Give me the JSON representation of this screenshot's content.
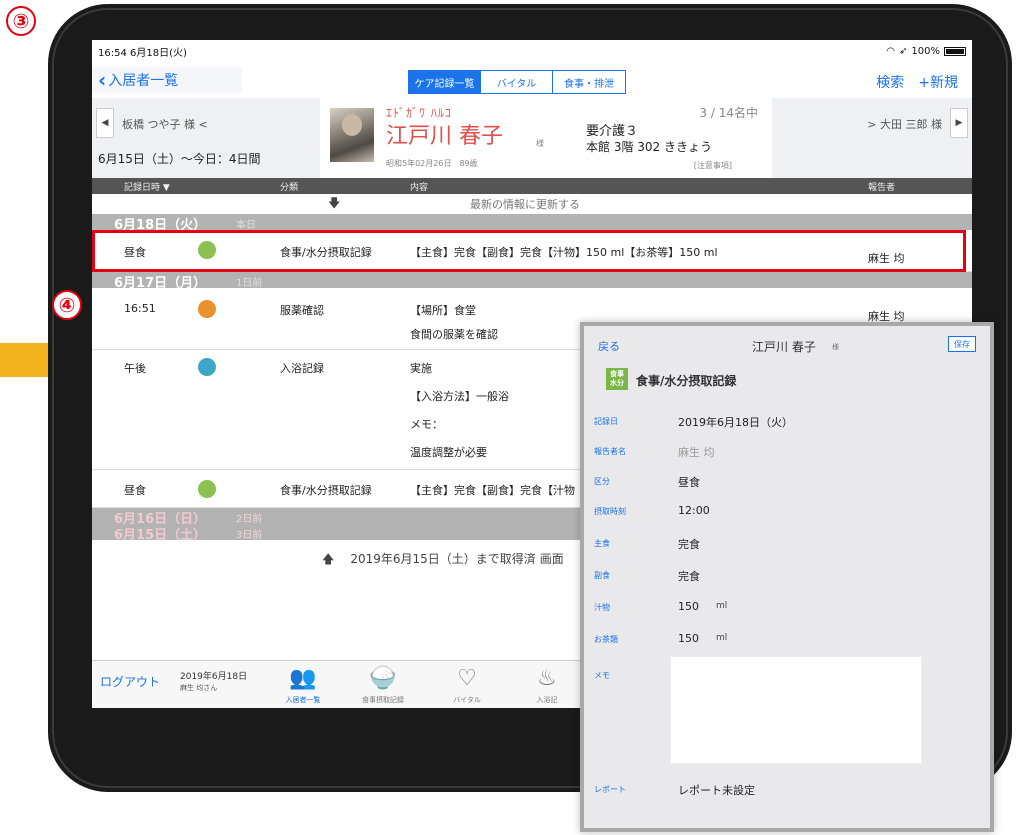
{
  "markers": {
    "step3": "③",
    "step4": "④"
  },
  "status": {
    "time": "16:54",
    "date": "6月18日(火)",
    "battery": "100%"
  },
  "nav": {
    "back": "入居者一覧",
    "tabs": [
      "ケア記録一覧",
      "バイタル",
      "食事・排泄"
    ],
    "active_tab": 0,
    "search": "検索",
    "new": "+新規"
  },
  "resident": {
    "prev": "板橋 つや子 様 <",
    "next": "> 大田 三郎 様",
    "range": "6月15日（土）〜今日：4日間",
    "kana": "ｴﾄﾞｶﾞﾜ ﾊﾙｺ",
    "name": "江戸川 春子",
    "sama": "様",
    "birth": "昭和5年02月26日　89歳",
    "count": "3 / 14名中",
    "care": "要介護３",
    "room": "本館 3階 302 ききょう",
    "notice": "[注意事項]"
  },
  "table_header": {
    "datetime": "記録日時 ▼",
    "category": "分類",
    "content": "内容",
    "reporter": "報告者"
  },
  "refresh_text": "最新の情報に更新する",
  "days": [
    {
      "date": "6月18日（火）",
      "rel": "本日"
    },
    {
      "date": "6月17日（月）",
      "rel": "1日前"
    },
    {
      "date": "6月16日（日）",
      "rel": "2日前"
    },
    {
      "date": "6月15日（土）",
      "rel": "3日前"
    }
  ],
  "records": [
    {
      "time": "昼食",
      "dot_color": "#8cc152",
      "category": "食事/水分摂取記録",
      "content": "【主食】完食【副食】完食【汁物】150 ml【お茶等】150 ml",
      "reporter": "麻生 均"
    },
    {
      "time": "16:51",
      "dot_color": "#e8912d",
      "category": "服薬確認",
      "content": "【場所】食堂",
      "content2": "食間の服薬を確認",
      "reporter": "麻生 均"
    },
    {
      "time": "午後",
      "dot_color": "#3ea6c9",
      "category": "入浴記録",
      "content": "実施",
      "content2": "【入浴方法】一般浴",
      "content3": "メモ：",
      "content4": "温度調整が必要"
    },
    {
      "time": "昼食",
      "dot_color": "#8cc152",
      "category": "食事/水分摂取記録",
      "content": "【主食】完食【副食】完食【汁物"
    }
  ],
  "loaded_text": "2019年6月15日（土）まで取得済",
  "loaded_more": "画面",
  "tabbar": {
    "logout": "ログアウト",
    "date": "2019年6月18日",
    "user": "麻生 均さん",
    "tabs": [
      "入居者一覧",
      "食事摂取記録",
      "バイタル",
      "入浴記"
    ]
  },
  "panel": {
    "back": "戻る",
    "name": "江戸川 春子",
    "sama": "様",
    "save": "保存",
    "badge": "食事水分",
    "badge1": "食事",
    "badge2": "水分",
    "title": "食事/水分摂取記録",
    "fields": [
      {
        "label": "記録日",
        "value": "2019年6月18日（火）"
      },
      {
        "label": "報告者名",
        "value": "麻生 均"
      },
      {
        "label": "区分",
        "value": "昼食"
      },
      {
        "label": "摂取時刻",
        "value": "12:00"
      },
      {
        "label": "主食",
        "value": "完食"
      },
      {
        "label": "副食",
        "value": "完食"
      },
      {
        "label": "汁物",
        "value": "150",
        "unit": "ml"
      },
      {
        "label": "お茶類",
        "value": "150",
        "unit": "ml"
      },
      {
        "label": "メモ",
        "value": ""
      }
    ],
    "report_label": "レポート",
    "report_value": "レポート未設定"
  }
}
